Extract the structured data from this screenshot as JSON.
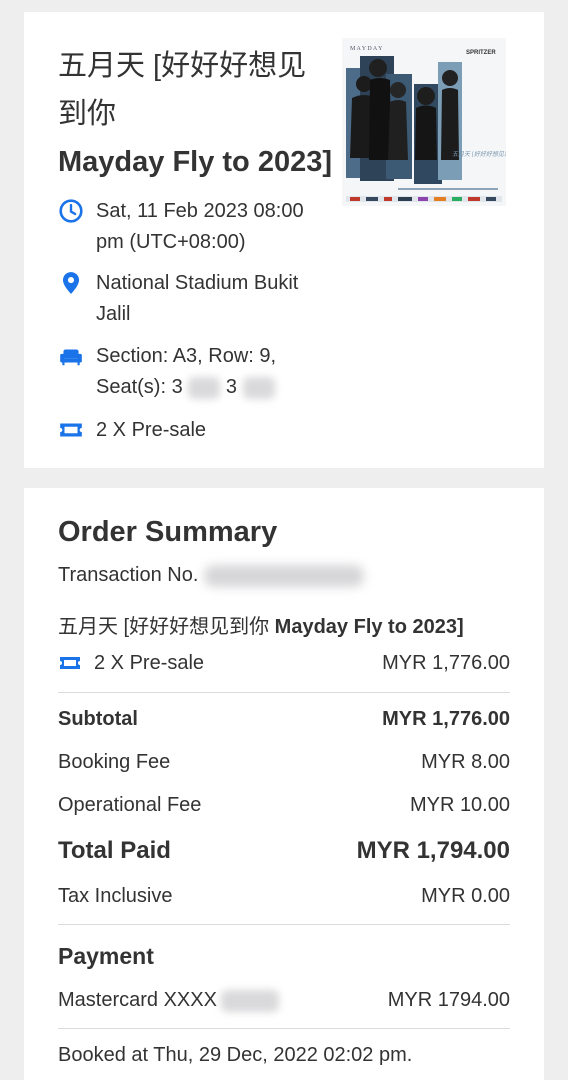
{
  "event": {
    "title_cn": "五月天 [好好好想见到你",
    "title_en": "Mayday Fly to 2023]",
    "poster": {
      "top_letters": "M  A  Y  D  A  Y",
      "brand": "SPRITZER",
      "caption": "五月天 [好好好想见到你]"
    },
    "datetime": "Sat, 11 Feb 2023 08:00 pm (UTC+08:00)",
    "venue": "National Stadium Bukit Jalil",
    "seat_prefix": "Section: A3, Row: 9, Seat(s): 3",
    "seat_mid": "3",
    "ticket": "2 X Pre-sale"
  },
  "order": {
    "heading": "Order Summary",
    "transaction_label": "Transaction No.",
    "event_cn": "五月天 [好好好想见到你 ",
    "event_en": "Mayday Fly to 2023]",
    "ticket_label": "2 X Pre-sale",
    "ticket_amount": "MYR 1,776.00",
    "subtotal_label": "Subtotal",
    "subtotal_amount": "MYR 1,776.00",
    "booking_fee_label": "Booking Fee",
    "booking_fee_amount": "MYR 8.00",
    "operational_fee_label": "Operational Fee",
    "operational_fee_amount": "MYR 10.00",
    "total_label": "Total Paid",
    "total_amount": "MYR 1,794.00",
    "tax_label": "Tax Inclusive",
    "tax_amount": "MYR 0.00",
    "payment_heading": "Payment",
    "card_label": "Mastercard XXXX",
    "card_amount": "MYR 1794.00",
    "booked_at": "Booked at Thu, 29 Dec, 2022 02:02 pm."
  },
  "colors": {
    "accent": "#1a73e8",
    "page_bg": "#eeeeef",
    "card_bg": "#ffffff"
  }
}
